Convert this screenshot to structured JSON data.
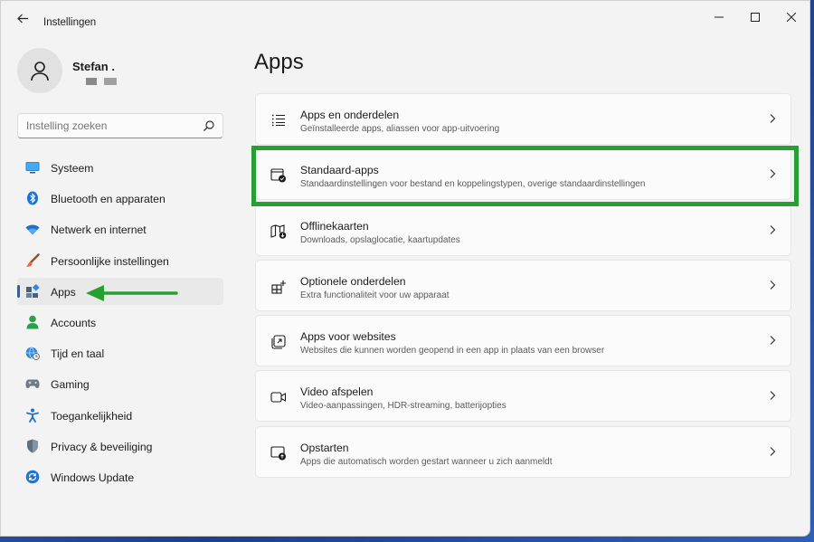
{
  "window": {
    "title": "Instellingen",
    "controls": [
      "minimize-icon",
      "maximize-icon",
      "close-icon"
    ]
  },
  "user": {
    "name": "Stefan ."
  },
  "search": {
    "placeholder": "Instelling zoeken"
  },
  "sidebar": {
    "items": [
      {
        "label": "Systeem",
        "icon": "monitor-icon",
        "active": false
      },
      {
        "label": "Bluetooth en apparaten",
        "icon": "bluetooth-icon",
        "active": false
      },
      {
        "label": "Netwerk en internet",
        "icon": "wifi-icon",
        "active": false
      },
      {
        "label": "Persoonlijke instellingen",
        "icon": "brush-icon",
        "active": false
      },
      {
        "label": "Apps",
        "icon": "apps-icon",
        "active": true
      },
      {
        "label": "Accounts",
        "icon": "person-icon",
        "active": false
      },
      {
        "label": "Tijd en taal",
        "icon": "globe-clock-icon",
        "active": false
      },
      {
        "label": "Gaming",
        "icon": "gamepad-icon",
        "active": false
      },
      {
        "label": "Toegankelijkheid",
        "icon": "accessibility-icon",
        "active": false
      },
      {
        "label": "Privacy & beveiliging",
        "icon": "shield-icon",
        "active": false
      },
      {
        "label": "Windows Update",
        "icon": "update-icon",
        "active": false
      }
    ]
  },
  "main": {
    "title": "Apps",
    "cards": [
      {
        "title": "Apps en onderdelen",
        "desc": "Geïnstalleerde apps, aliassen voor app-uitvoering",
        "icon": "list-icon"
      },
      {
        "title": "Standaard-apps",
        "desc": "Standaardinstellingen voor bestand en koppelingstypen, overige standaardinstellingen",
        "icon": "default-apps-icon"
      },
      {
        "title": "Offlinekaarten",
        "desc": "Downloads, opslaglocatie, kaartupdates",
        "icon": "map-download-icon"
      },
      {
        "title": "Optionele onderdelen",
        "desc": "Extra functionaliteit voor uw apparaat",
        "icon": "add-grid-icon"
      },
      {
        "title": "Apps voor websites",
        "desc": "Websites die kunnen worden geopend in een app in plaats van een browser",
        "icon": "open-in-app-icon"
      },
      {
        "title": "Video afspelen",
        "desc": "Video-aanpassingen, HDR-streaming, batterijopties",
        "icon": "video-icon"
      },
      {
        "title": "Opstarten",
        "desc": "Apps die automatisch worden gestart wanneer u zich aanmeldt",
        "icon": "startup-icon"
      }
    ]
  },
  "colors": {
    "accent": "#1f5fc6",
    "highlight": "#27a032"
  }
}
